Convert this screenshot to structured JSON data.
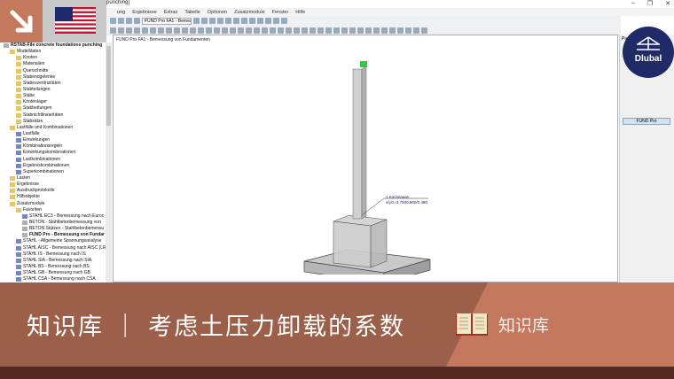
{
  "window": {
    "title_fragment": "punching]",
    "controls": [
      "–",
      "❐",
      "✕"
    ]
  },
  "menu": [
    "ung",
    "Ergebnisse",
    "Extras",
    "Tabelle",
    "Optionen",
    "Zusatzmodule",
    "Fenster",
    "Hilfe"
  ],
  "toolbar": {
    "module_combo": "FUND Pro FA1 - Bemessun"
  },
  "view": {
    "title": "FUND Pro FA1 - Bemessung von Fundamenten",
    "annotation_line1": "1 Köcherwas",
    "annotation_line2": "x/y/z=3.7900,900/0.490"
  },
  "tree": [
    {
      "label": "RSTAB-File concrete foundations punching",
      "lvl": 0,
      "bold": true,
      "icon": "d"
    },
    {
      "label": "Modelldaten",
      "lvl": 1
    },
    {
      "label": "Knoten",
      "lvl": 2
    },
    {
      "label": "Materialien",
      "lvl": 2
    },
    {
      "label": "Querschnitte",
      "lvl": 2
    },
    {
      "label": "Stabendgelenke",
      "lvl": 2
    },
    {
      "label": "Stabexzentrizitäten",
      "lvl": 2
    },
    {
      "label": "Stabteilungen",
      "lvl": 2
    },
    {
      "label": "Stäbe",
      "lvl": 2
    },
    {
      "label": "Knotenlager",
      "lvl": 2
    },
    {
      "label": "Stabbettungen",
      "lvl": 2
    },
    {
      "label": "Stabnichtlinearitäten",
      "lvl": 2
    },
    {
      "label": "Stabsätze",
      "lvl": 2
    },
    {
      "label": "Lastfälle und Kombinationen",
      "lvl": 1
    },
    {
      "label": "Lastfälle",
      "lvl": 2,
      "icon": "m"
    },
    {
      "label": "Einwirkungen",
      "lvl": 2,
      "icon": "m"
    },
    {
      "label": "Kombinationsregeln",
      "lvl": 2,
      "icon": "m"
    },
    {
      "label": "Einwirkungskombinationen",
      "lvl": 2,
      "icon": "m"
    },
    {
      "label": "Lastkombinationen",
      "lvl": 2,
      "icon": "m"
    },
    {
      "label": "Ergebniskombinationen",
      "lvl": 2,
      "icon": "m"
    },
    {
      "label": "Superkombinationen",
      "lvl": 2,
      "icon": "m"
    },
    {
      "label": "Lasten",
      "lvl": 1
    },
    {
      "label": "Ergebnisse",
      "lvl": 1
    },
    {
      "label": "Ausdruckprotokolle",
      "lvl": 1
    },
    {
      "label": "Hilfsobjekte",
      "lvl": 1
    },
    {
      "label": "Zusatzmodule",
      "lvl": 1
    },
    {
      "label": "Favoriten",
      "lvl": 2
    },
    {
      "label": "STAHL EC3 - Bemessung nach Euroc",
      "lvl": 3,
      "icon": "m"
    },
    {
      "label": "BETON - Stahlbetonbemessung von",
      "lvl": 3,
      "icon": "d"
    },
    {
      "label": "BETON Stützen - Stahlbetonbemessu",
      "lvl": 3,
      "icon": "d"
    },
    {
      "label": "FUND Pro - Bemessung von Fundar",
      "lvl": 3,
      "bold": true,
      "icon": "d"
    },
    {
      "label": "STAHL - Allgemeine Spannungsanalyse",
      "lvl": 2,
      "icon": "m"
    },
    {
      "label": "STAHL AISC - Bemessung nach AISC (LR",
      "lvl": 2,
      "icon": "m"
    },
    {
      "label": "STAHL IS - Bemessung nach IS",
      "lvl": 2,
      "icon": "m"
    },
    {
      "label": "STAHL SIA - Bemessung nach SIA",
      "lvl": 2,
      "icon": "m"
    },
    {
      "label": "STAHL BS - Bemessung nach BS",
      "lvl": 2,
      "icon": "m"
    },
    {
      "label": "STAHL GB - Bemessung nach GB",
      "lvl": 2,
      "icon": "m"
    },
    {
      "label": "STAHL CSA - Bemessung nach CSA",
      "lvl": 2,
      "icon": "m"
    }
  ],
  "right_panel": {
    "header": "Pa",
    "button": "FUND Pro"
  },
  "logo": {
    "text": "Dlubal"
  },
  "banner": {
    "title": "知识库 ｜ 考虑土压力卸载的系数",
    "label": "知识库"
  },
  "colors": {
    "accent": "#c4785e",
    "banner_dark": "#9c5f4a",
    "bottom": "#512a20",
    "dlubal": "#1f2a66"
  }
}
